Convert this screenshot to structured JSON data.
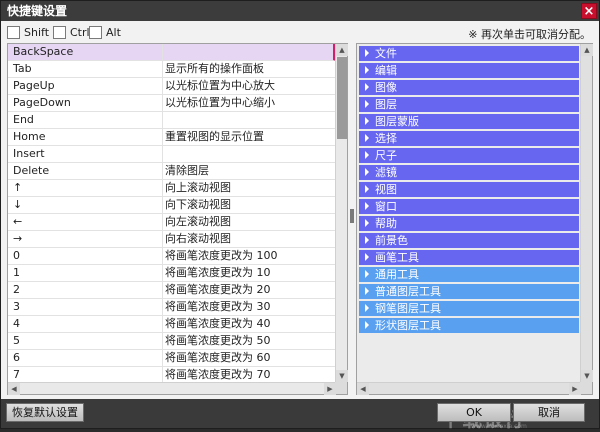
{
  "window": {
    "title": "快捷键设置",
    "close_glyph": "×"
  },
  "modifiers": [
    {
      "label": "Shift",
      "checked": false
    },
    {
      "label": "Ctrl",
      "checked": false
    },
    {
      "label": "Alt",
      "checked": false
    }
  ],
  "hint": "※ 再次单击可取消分配。",
  "shortcuts": [
    {
      "key": "BackSpace",
      "action": ""
    },
    {
      "key": "Tab",
      "action": "显示所有的操作面板"
    },
    {
      "key": "PageUp",
      "action": "以光标位置为中心放大"
    },
    {
      "key": "PageDown",
      "action": "以光标位置为中心缩小"
    },
    {
      "key": "End",
      "action": ""
    },
    {
      "key": "Home",
      "action": "重置视图的显示位置"
    },
    {
      "key": "Insert",
      "action": ""
    },
    {
      "key": "Delete",
      "action": "清除图层"
    },
    {
      "key": "↑",
      "action": "向上滚动视图"
    },
    {
      "key": "↓",
      "action": "向下滚动视图"
    },
    {
      "key": "←",
      "action": "向左滚动视图"
    },
    {
      "key": "→",
      "action": "向右滚动视图"
    },
    {
      "key": "0",
      "action": "将画笔浓度更改为 100"
    },
    {
      "key": "1",
      "action": "将画笔浓度更改为 10"
    },
    {
      "key": "2",
      "action": "将画笔浓度更改为 20"
    },
    {
      "key": "3",
      "action": "将画笔浓度更改为 30"
    },
    {
      "key": "4",
      "action": "将画笔浓度更改为 40"
    },
    {
      "key": "5",
      "action": "将画笔浓度更改为 50"
    },
    {
      "key": "6",
      "action": "将画笔浓度更改为 60"
    },
    {
      "key": "7",
      "action": "将画笔浓度更改为 70"
    }
  ],
  "selected_row": 0,
  "categories": [
    {
      "label": "文件",
      "color": "purple"
    },
    {
      "label": "编辑",
      "color": "purple"
    },
    {
      "label": "图像",
      "color": "purple"
    },
    {
      "label": "图层",
      "color": "purple"
    },
    {
      "label": "图层蒙版",
      "color": "purple"
    },
    {
      "label": "选择",
      "color": "purple"
    },
    {
      "label": "尺子",
      "color": "purple"
    },
    {
      "label": "滤镜",
      "color": "purple"
    },
    {
      "label": "视图",
      "color": "purple"
    },
    {
      "label": "窗口",
      "color": "purple"
    },
    {
      "label": "帮助",
      "color": "purple"
    },
    {
      "label": "前景色",
      "color": "purple"
    },
    {
      "label": "画笔工具",
      "color": "purple"
    },
    {
      "label": "通用工具",
      "color": "blue"
    },
    {
      "label": "普通图层工具",
      "color": "blue"
    },
    {
      "label": "钢笔图层工具",
      "color": "blue"
    },
    {
      "label": "形状图层工具",
      "color": "blue"
    }
  ],
  "colors": {
    "purple": "#6666f0",
    "blue": "#5aa0f0"
  },
  "buttons": {
    "reset": "恢复默认设置",
    "ok": "OK",
    "cancel": "取消"
  },
  "watermark": {
    "main": "下载银行",
    "sub": "www.downxia.com"
  }
}
